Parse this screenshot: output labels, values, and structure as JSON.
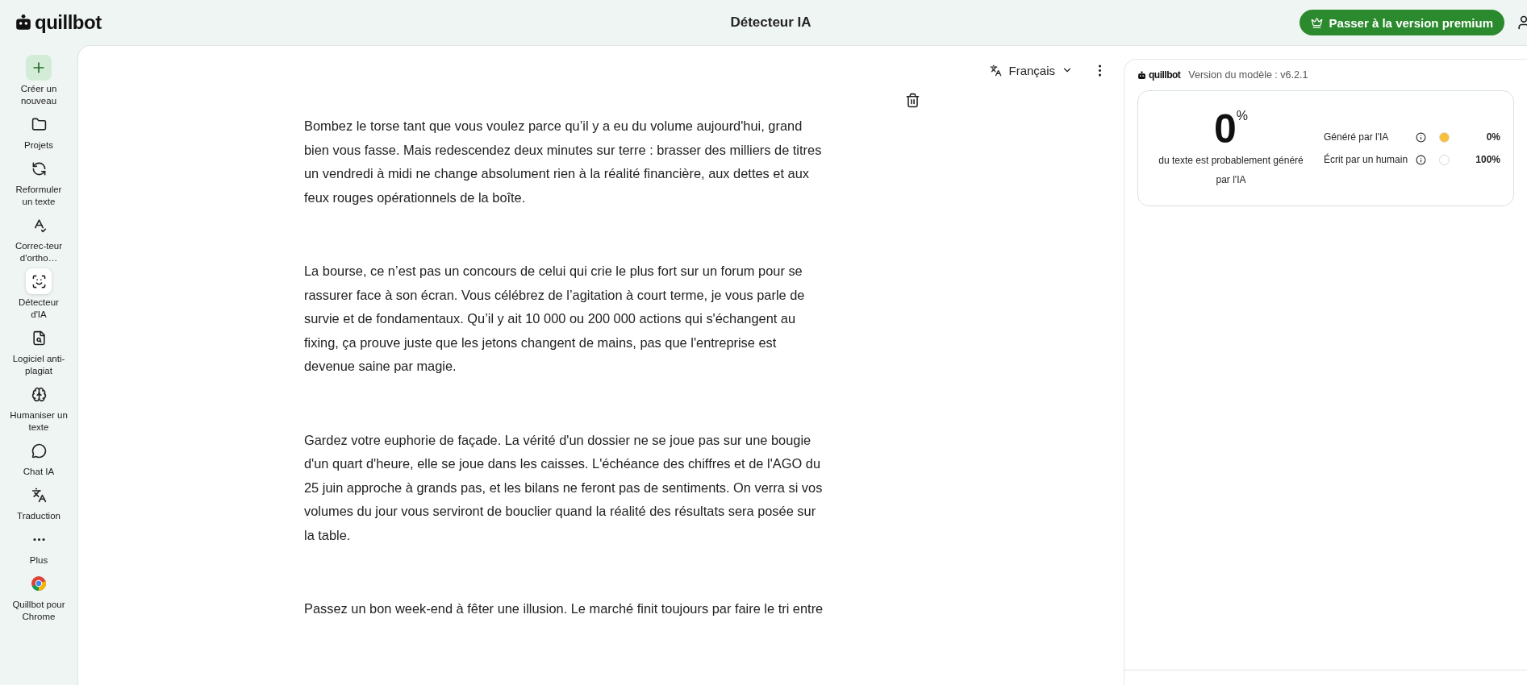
{
  "brand": {
    "name": "quillbot"
  },
  "header": {
    "title": "Détecteur IA",
    "premium_button": "Passer à la version premium"
  },
  "sidebar": {
    "items": [
      {
        "label": "Créer un nouveau",
        "kind": "create",
        "selected": false
      },
      {
        "label": "Projets",
        "kind": "tool",
        "selected": false
      },
      {
        "label": "Reformuler un texte",
        "kind": "tool",
        "selected": false
      },
      {
        "label": "Correc-teur d'ortho…",
        "kind": "tool",
        "selected": false
      },
      {
        "label": "Détecteur d'IA",
        "kind": "tool",
        "selected": true
      },
      {
        "label": "Logiciel anti-plagiat",
        "kind": "tool",
        "selected": false
      },
      {
        "label": "Humaniser un texte",
        "kind": "tool",
        "selected": false
      },
      {
        "label": "Chat IA",
        "kind": "tool",
        "selected": false
      },
      {
        "label": "Traduction",
        "kind": "tool",
        "selected": false
      },
      {
        "label": "Plus",
        "kind": "tool",
        "selected": false
      },
      {
        "label": "Quillbot pour Chrome",
        "kind": "tool",
        "selected": false
      }
    ]
  },
  "editor": {
    "language": "Français",
    "paragraphs": [
      "Bombez le torse tant que vous voulez parce qu’il y a eu du volume aujourd'hui, grand bien vous fasse. Mais redescendez deux minutes sur terre : brasser des milliers de titres un vendredi à midi ne change absolument rien à la réalité financière, aux dettes et aux feux rouges opérationnels de la boîte.",
      "La bourse, ce n’est pas un concours de celui qui crie le plus fort sur un forum pour se rassurer face à son écran. Vous célébrez de l’agitation à court terme, je vous parle de survie et de fondamentaux. Qu’il y ait 10 000 ou 200 000 actions qui s'échangent au fixing, ça prouve juste que les jetons changent de mains, pas que l'entreprise est devenue saine par magie.",
      "Gardez votre euphorie de façade. La vérité d'un dossier ne se joue pas sur une bougie d'un quart d'heure, elle se joue dans les caisses. L'échéance des chiffres et de l'AGO du 25 juin approche à grands pas, et les bilans ne feront pas de sentiments. On verra si vos volumes du jour vous serviront de bouclier quand la réalité des résultats sera posée sur la table.",
      "Passez un bon week-end à fêter une illusion. Le marché finit toujours par faire le tri entre"
    ]
  },
  "results": {
    "brand": "quillbot",
    "model_version": "Version du modèle : v6.2.1",
    "score": "0",
    "score_unit": "%",
    "score_caption": "du texte est probablement généré par l'IA",
    "categories": [
      {
        "label": "Généré par l'IA",
        "value": "0%",
        "color": "#f9bf3b"
      },
      {
        "label": "Écrit par un humain",
        "value": "100%",
        "color": "#ffffff"
      }
    ]
  }
}
